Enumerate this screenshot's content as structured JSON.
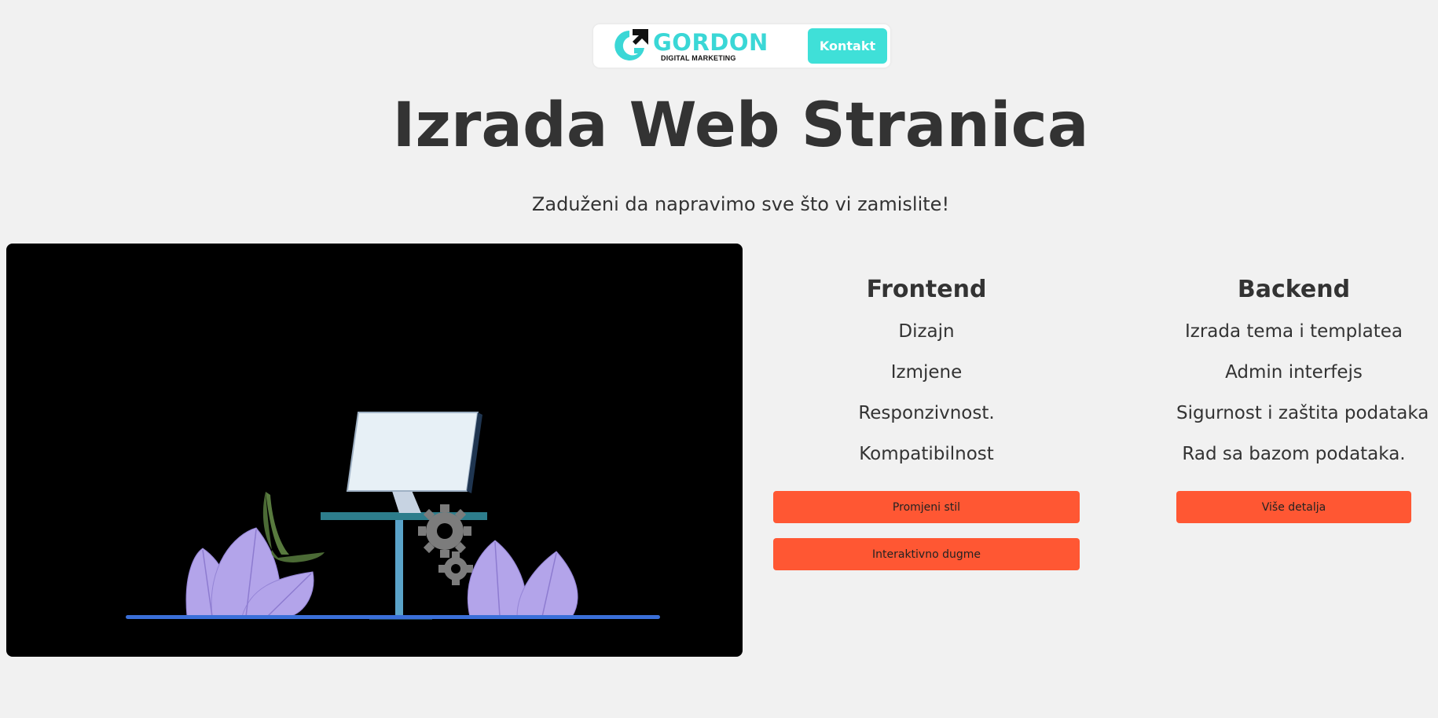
{
  "header": {
    "logo_word": "GORDON",
    "logo_sub": "DIGITAL MARKETING",
    "contact_label": "Kontakt"
  },
  "hero": {
    "title": "Izrada Web Stranica",
    "subtitle": "Zaduženi da napravimo sve što vi zamislite!"
  },
  "frontend": {
    "heading": "Frontend",
    "items": [
      "Dizajn",
      "Izmjene",
      "Responzivnost.",
      "Kompatibilnost"
    ],
    "buttons": [
      "Promjeni stil",
      "Interaktivno dugme"
    ]
  },
  "backend": {
    "heading": "Backend",
    "items": [
      "Izrada tema i templatea",
      "Admin interfejs",
      "Sigurnost i zaštita podataka",
      "Rad sa bazom podataka."
    ],
    "buttons": [
      "Više detalja"
    ]
  },
  "colors": {
    "accent": "#3fe0d8",
    "button": "#ff5733",
    "text": "#333333",
    "background": "#f1f1f1"
  },
  "icons": [
    "gordon-logo-icon",
    "workspace-illustration"
  ]
}
